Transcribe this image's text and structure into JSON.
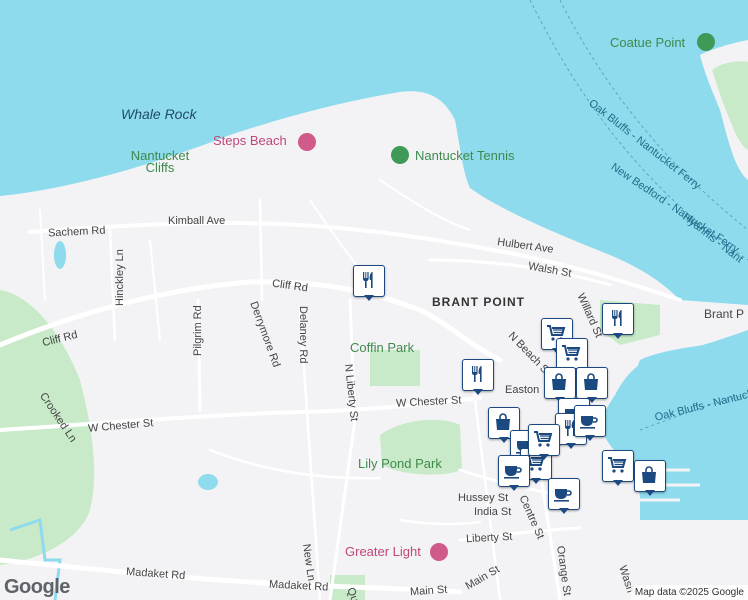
{
  "map": {
    "water_labels": [
      "Whale Rock"
    ],
    "area_labels": [
      "BRANT POINT",
      "Brant P"
    ],
    "park_labels": [
      "Nantucket Cliffs",
      "Coffin Park",
      "Lily Pond Park",
      "Coatue Point"
    ],
    "poi_labels": [
      "Steps Beach",
      "Nantucket Tennis",
      "Greater Light"
    ],
    "ferry_labels": [
      "Oak Bluffs - Nantucket Ferry",
      "Hyannis - Nant",
      "New Bedford - Nantucket Ferry",
      "Oak Bluffs - Nantucke"
    ],
    "streets": {
      "sachem": "Sachem Rd",
      "kimball": "Kimball Ave",
      "hinckley": "Hinckley Ln",
      "cliff_left": "Cliff Rd",
      "cliff_top": "Cliff Rd",
      "pilgrim": "Pilgrim Rd",
      "derrymore": "Derrymore Rd",
      "delaney": "Delaney Rd",
      "n_liberty": "N Liberty St",
      "crooked": "Crooked Ln",
      "w_chester_left": "W Chester St",
      "w_chester_right": "W Chester St",
      "hulbert": "Hulbert Ave",
      "walsh": "Walsh St",
      "willard": "Willard St",
      "n_beach": "N Beach St",
      "easton": "Easton",
      "hussey": "Hussey St",
      "centre": "Centre St",
      "india": "India St",
      "liberty": "Liberty St",
      "orange": "Orange St",
      "new_ln": "New Ln",
      "madaket_left": "Madaket Rd",
      "madaket_right": "Madaket Rd",
      "main_st": "Main St",
      "main_st2": "Main St",
      "quaker": "Qu",
      "wash": "Wash"
    },
    "markers": [
      {
        "type": "restaurant",
        "icon": "fork-knife-icon"
      },
      {
        "type": "restaurant",
        "icon": "fork-knife-icon"
      },
      {
        "type": "restaurant",
        "icon": "fork-knife-icon"
      },
      {
        "type": "grocery",
        "icon": "shopping-cart-icon"
      },
      {
        "type": "grocery",
        "icon": "shopping-cart-icon"
      },
      {
        "type": "shopping",
        "icon": "shopping-bag-icon"
      },
      {
        "type": "shopping",
        "icon": "shopping-bag-icon"
      },
      {
        "type": "cafe",
        "icon": "coffee-cup-icon"
      },
      {
        "type": "restaurant",
        "icon": "fork-knife-icon"
      },
      {
        "type": "cafe",
        "icon": "coffee-cup-icon"
      },
      {
        "type": "shopping",
        "icon": "shopping-bag-icon"
      },
      {
        "type": "cafe",
        "icon": "coffee-cup-icon"
      },
      {
        "type": "grocery",
        "icon": "shopping-cart-icon"
      },
      {
        "type": "grocery",
        "icon": "shopping-cart-icon"
      },
      {
        "type": "grocery",
        "icon": "shopping-cart-icon"
      },
      {
        "type": "shopping",
        "icon": "shopping-bag-icon"
      },
      {
        "type": "cafe",
        "icon": "coffee-cup-icon"
      },
      {
        "type": "cafe",
        "icon": "coffee-cup-icon"
      }
    ],
    "colors": {
      "water": "#8edbed",
      "land": "#f3f3f6",
      "park": "#c8eac9",
      "marker_border": "#1c4a80",
      "road": "#ffffff"
    }
  },
  "branding": {
    "logo": "Google",
    "attribution": "Map data ©2025 Google"
  }
}
